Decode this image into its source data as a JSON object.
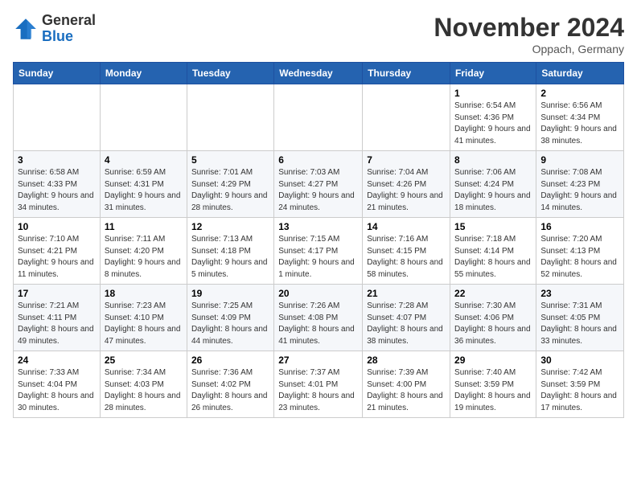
{
  "header": {
    "logo_general": "General",
    "logo_blue": "Blue",
    "month_title": "November 2024",
    "location": "Oppach, Germany"
  },
  "weekdays": [
    "Sunday",
    "Monday",
    "Tuesday",
    "Wednesday",
    "Thursday",
    "Friday",
    "Saturday"
  ],
  "weeks": [
    [
      {
        "day": "",
        "info": ""
      },
      {
        "day": "",
        "info": ""
      },
      {
        "day": "",
        "info": ""
      },
      {
        "day": "",
        "info": ""
      },
      {
        "day": "",
        "info": ""
      },
      {
        "day": "1",
        "info": "Sunrise: 6:54 AM\nSunset: 4:36 PM\nDaylight: 9 hours and 41 minutes."
      },
      {
        "day": "2",
        "info": "Sunrise: 6:56 AM\nSunset: 4:34 PM\nDaylight: 9 hours and 38 minutes."
      }
    ],
    [
      {
        "day": "3",
        "info": "Sunrise: 6:58 AM\nSunset: 4:33 PM\nDaylight: 9 hours and 34 minutes."
      },
      {
        "day": "4",
        "info": "Sunrise: 6:59 AM\nSunset: 4:31 PM\nDaylight: 9 hours and 31 minutes."
      },
      {
        "day": "5",
        "info": "Sunrise: 7:01 AM\nSunset: 4:29 PM\nDaylight: 9 hours and 28 minutes."
      },
      {
        "day": "6",
        "info": "Sunrise: 7:03 AM\nSunset: 4:27 PM\nDaylight: 9 hours and 24 minutes."
      },
      {
        "day": "7",
        "info": "Sunrise: 7:04 AM\nSunset: 4:26 PM\nDaylight: 9 hours and 21 minutes."
      },
      {
        "day": "8",
        "info": "Sunrise: 7:06 AM\nSunset: 4:24 PM\nDaylight: 9 hours and 18 minutes."
      },
      {
        "day": "9",
        "info": "Sunrise: 7:08 AM\nSunset: 4:23 PM\nDaylight: 9 hours and 14 minutes."
      }
    ],
    [
      {
        "day": "10",
        "info": "Sunrise: 7:10 AM\nSunset: 4:21 PM\nDaylight: 9 hours and 11 minutes."
      },
      {
        "day": "11",
        "info": "Sunrise: 7:11 AM\nSunset: 4:20 PM\nDaylight: 9 hours and 8 minutes."
      },
      {
        "day": "12",
        "info": "Sunrise: 7:13 AM\nSunset: 4:18 PM\nDaylight: 9 hours and 5 minutes."
      },
      {
        "day": "13",
        "info": "Sunrise: 7:15 AM\nSunset: 4:17 PM\nDaylight: 9 hours and 1 minute."
      },
      {
        "day": "14",
        "info": "Sunrise: 7:16 AM\nSunset: 4:15 PM\nDaylight: 8 hours and 58 minutes."
      },
      {
        "day": "15",
        "info": "Sunrise: 7:18 AM\nSunset: 4:14 PM\nDaylight: 8 hours and 55 minutes."
      },
      {
        "day": "16",
        "info": "Sunrise: 7:20 AM\nSunset: 4:13 PM\nDaylight: 8 hours and 52 minutes."
      }
    ],
    [
      {
        "day": "17",
        "info": "Sunrise: 7:21 AM\nSunset: 4:11 PM\nDaylight: 8 hours and 49 minutes."
      },
      {
        "day": "18",
        "info": "Sunrise: 7:23 AM\nSunset: 4:10 PM\nDaylight: 8 hours and 47 minutes."
      },
      {
        "day": "19",
        "info": "Sunrise: 7:25 AM\nSunset: 4:09 PM\nDaylight: 8 hours and 44 minutes."
      },
      {
        "day": "20",
        "info": "Sunrise: 7:26 AM\nSunset: 4:08 PM\nDaylight: 8 hours and 41 minutes."
      },
      {
        "day": "21",
        "info": "Sunrise: 7:28 AM\nSunset: 4:07 PM\nDaylight: 8 hours and 38 minutes."
      },
      {
        "day": "22",
        "info": "Sunrise: 7:30 AM\nSunset: 4:06 PM\nDaylight: 8 hours and 36 minutes."
      },
      {
        "day": "23",
        "info": "Sunrise: 7:31 AM\nSunset: 4:05 PM\nDaylight: 8 hours and 33 minutes."
      }
    ],
    [
      {
        "day": "24",
        "info": "Sunrise: 7:33 AM\nSunset: 4:04 PM\nDaylight: 8 hours and 30 minutes."
      },
      {
        "day": "25",
        "info": "Sunrise: 7:34 AM\nSunset: 4:03 PM\nDaylight: 8 hours and 28 minutes."
      },
      {
        "day": "26",
        "info": "Sunrise: 7:36 AM\nSunset: 4:02 PM\nDaylight: 8 hours and 26 minutes."
      },
      {
        "day": "27",
        "info": "Sunrise: 7:37 AM\nSunset: 4:01 PM\nDaylight: 8 hours and 23 minutes."
      },
      {
        "day": "28",
        "info": "Sunrise: 7:39 AM\nSunset: 4:00 PM\nDaylight: 8 hours and 21 minutes."
      },
      {
        "day": "29",
        "info": "Sunrise: 7:40 AM\nSunset: 3:59 PM\nDaylight: 8 hours and 19 minutes."
      },
      {
        "day": "30",
        "info": "Sunrise: 7:42 AM\nSunset: 3:59 PM\nDaylight: 8 hours and 17 minutes."
      }
    ]
  ]
}
